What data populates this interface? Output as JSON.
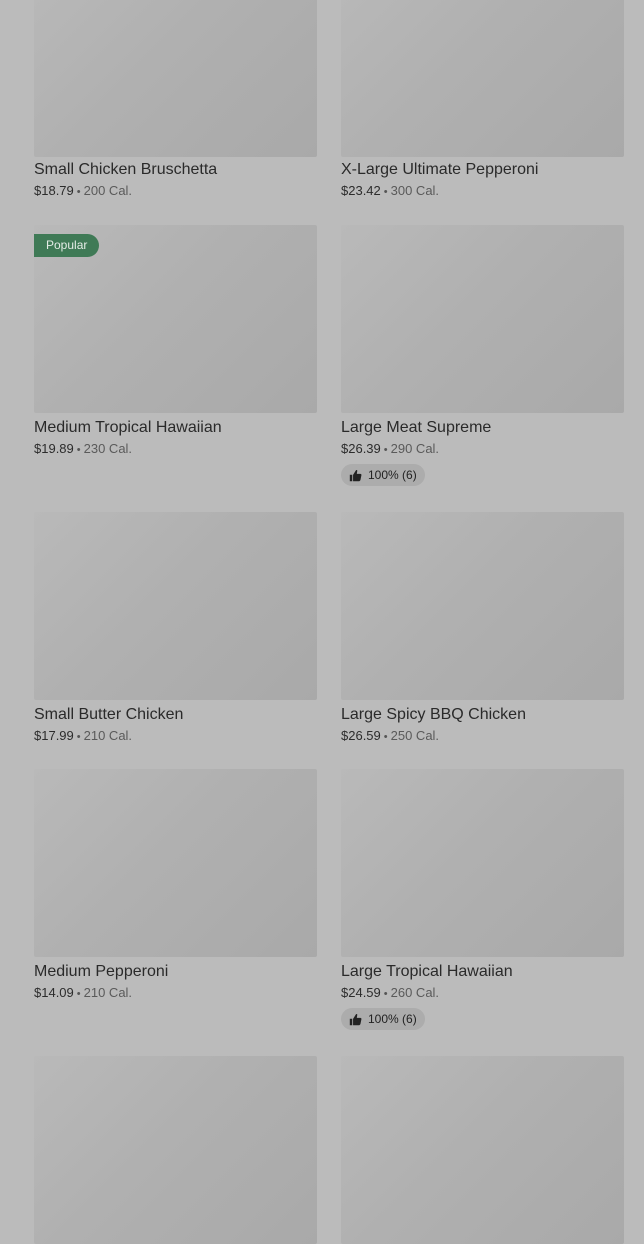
{
  "colors": {
    "background": "#bbbbbb",
    "popular_badge": "#3f7a56"
  },
  "items": [
    {
      "name": "",
      "price": "",
      "calories": "",
      "badge": "top"
    },
    {
      "name": "",
      "price": "",
      "calories": "",
      "badge": "top"
    },
    {
      "name": "Small Chicken Bruschetta",
      "price": "$18.79",
      "calories": "200 Cal."
    },
    {
      "name": "X-Large Ultimate Pepperoni",
      "price": "$23.42",
      "calories": "300 Cal."
    },
    {
      "name": "Medium Tropical Hawaiian",
      "price": "$19.89",
      "calories": "230 Cal.",
      "badge": "Popular"
    },
    {
      "name": "Large Meat Supreme",
      "price": "$26.39",
      "calories": "290 Cal.",
      "rating": "100% (6)"
    },
    {
      "name": "Small Butter Chicken",
      "price": "$17.99",
      "calories": "210 Cal."
    },
    {
      "name": "Large Spicy BBQ Chicken",
      "price": "$26.59",
      "calories": "250 Cal."
    },
    {
      "name": "Medium Pepperoni",
      "price": "$14.09",
      "calories": "210 Cal."
    },
    {
      "name": "Large Tropical Hawaiian",
      "price": "$24.59",
      "calories": "260 Cal.",
      "rating": "100% (6)"
    },
    {
      "name": "",
      "price": "",
      "calories": ""
    },
    {
      "name": "",
      "price": "",
      "calories": ""
    }
  ],
  "separator": "•",
  "icons": {
    "popular_badge": "popular-badge",
    "rating": "thumbs-up-icon"
  }
}
